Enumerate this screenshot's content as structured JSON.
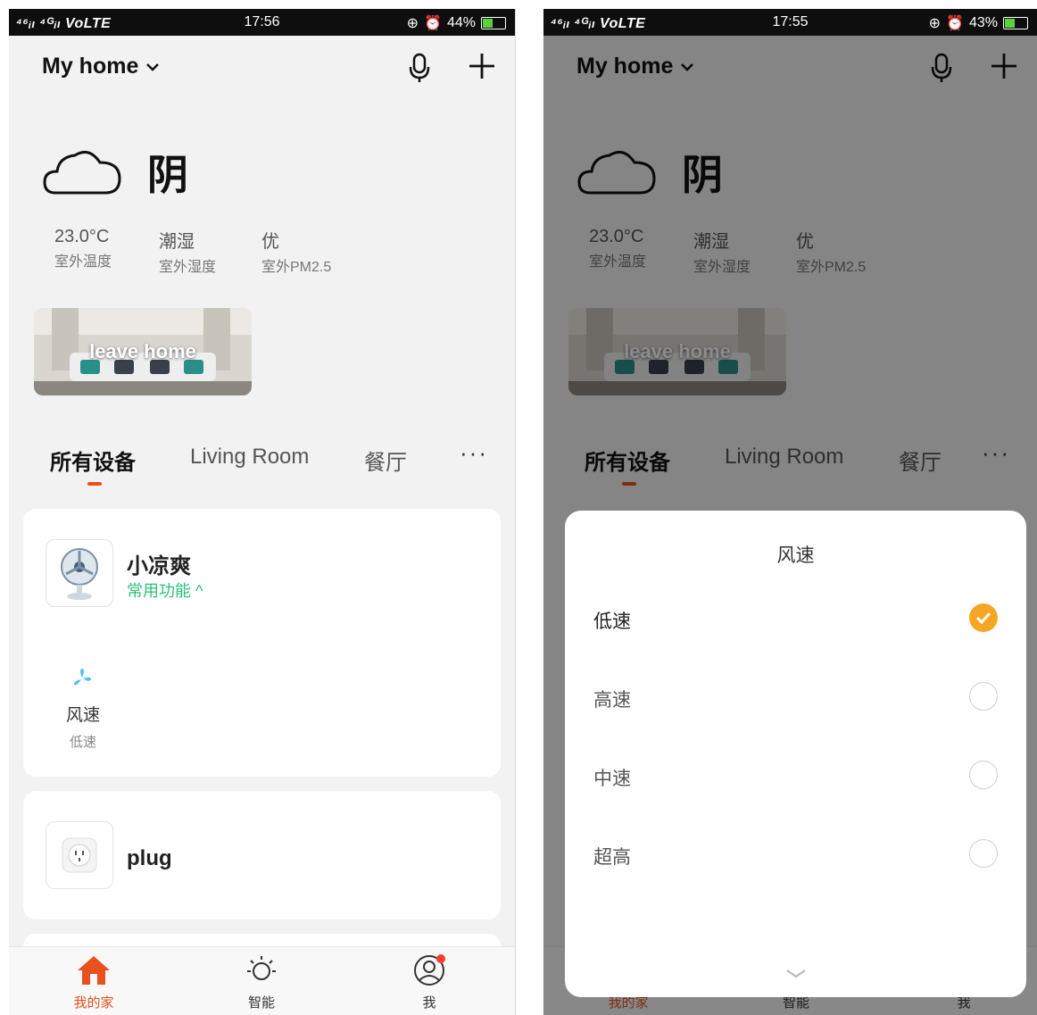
{
  "screens": [
    {
      "status": {
        "signal": "⁴⁶ᵢₗ ⁴ᴳᵢₗ VoLTE",
        "time": "17:56",
        "battery_pct": "44%",
        "battery_level": 0.44
      },
      "header": {
        "home_title": "My home"
      },
      "weather": {
        "condition": "阴",
        "metrics": [
          {
            "value": "23.0°C",
            "label": "室外温度"
          },
          {
            "value": "潮湿",
            "label": "室外湿度"
          },
          {
            "value": "优",
            "label": "室外PM2.5"
          }
        ]
      },
      "scene": {
        "label": "leave home"
      },
      "tabs": {
        "items": [
          "所有设备",
          "Living Room",
          "餐厅"
        ],
        "more": "···",
        "active": 0
      },
      "devices": [
        {
          "name": "小凉爽",
          "quick": "常用功能 ^",
          "function": {
            "label": "风速",
            "value": "低速"
          }
        },
        {
          "name": "plug"
        }
      ],
      "nav": [
        {
          "label": "我的家",
          "icon": "home-icon"
        },
        {
          "label": "智能",
          "icon": "sun-icon"
        },
        {
          "label": "我",
          "icon": "profile-icon"
        }
      ]
    },
    {
      "status": {
        "signal": "⁴⁶ᵢₗ ⁴ᴳᵢₗ VoLTE",
        "time": "17:55",
        "battery_pct": "43%",
        "battery_level": 0.43
      },
      "header": {
        "home_title": "My home"
      },
      "weather": {
        "condition": "阴",
        "metrics": [
          {
            "value": "23.0°C",
            "label": "室外温度"
          },
          {
            "value": "潮湿",
            "label": "室外湿度"
          },
          {
            "value": "优",
            "label": "室外PM2.5"
          }
        ]
      },
      "scene": {
        "label": "leave home"
      },
      "tabs": {
        "items": [
          "所有设备",
          "Living Room",
          "餐厅"
        ],
        "more": "···",
        "active": 0
      },
      "nav": [
        {
          "label": "我的家",
          "icon": "home-icon"
        },
        {
          "label": "智能",
          "icon": "sun-icon"
        },
        {
          "label": "我",
          "icon": "profile-icon"
        }
      ],
      "sheet": {
        "title": "风速",
        "options": [
          {
            "label": "低速",
            "selected": true
          },
          {
            "label": "高速",
            "selected": false
          },
          {
            "label": "中速",
            "selected": false
          },
          {
            "label": "超高",
            "selected": false
          }
        ]
      }
    }
  ],
  "colors": {
    "accent": "#e8501e",
    "green": "#2cbf7b",
    "check": "#f5a623",
    "fan_blue": "#4fc3f7"
  }
}
